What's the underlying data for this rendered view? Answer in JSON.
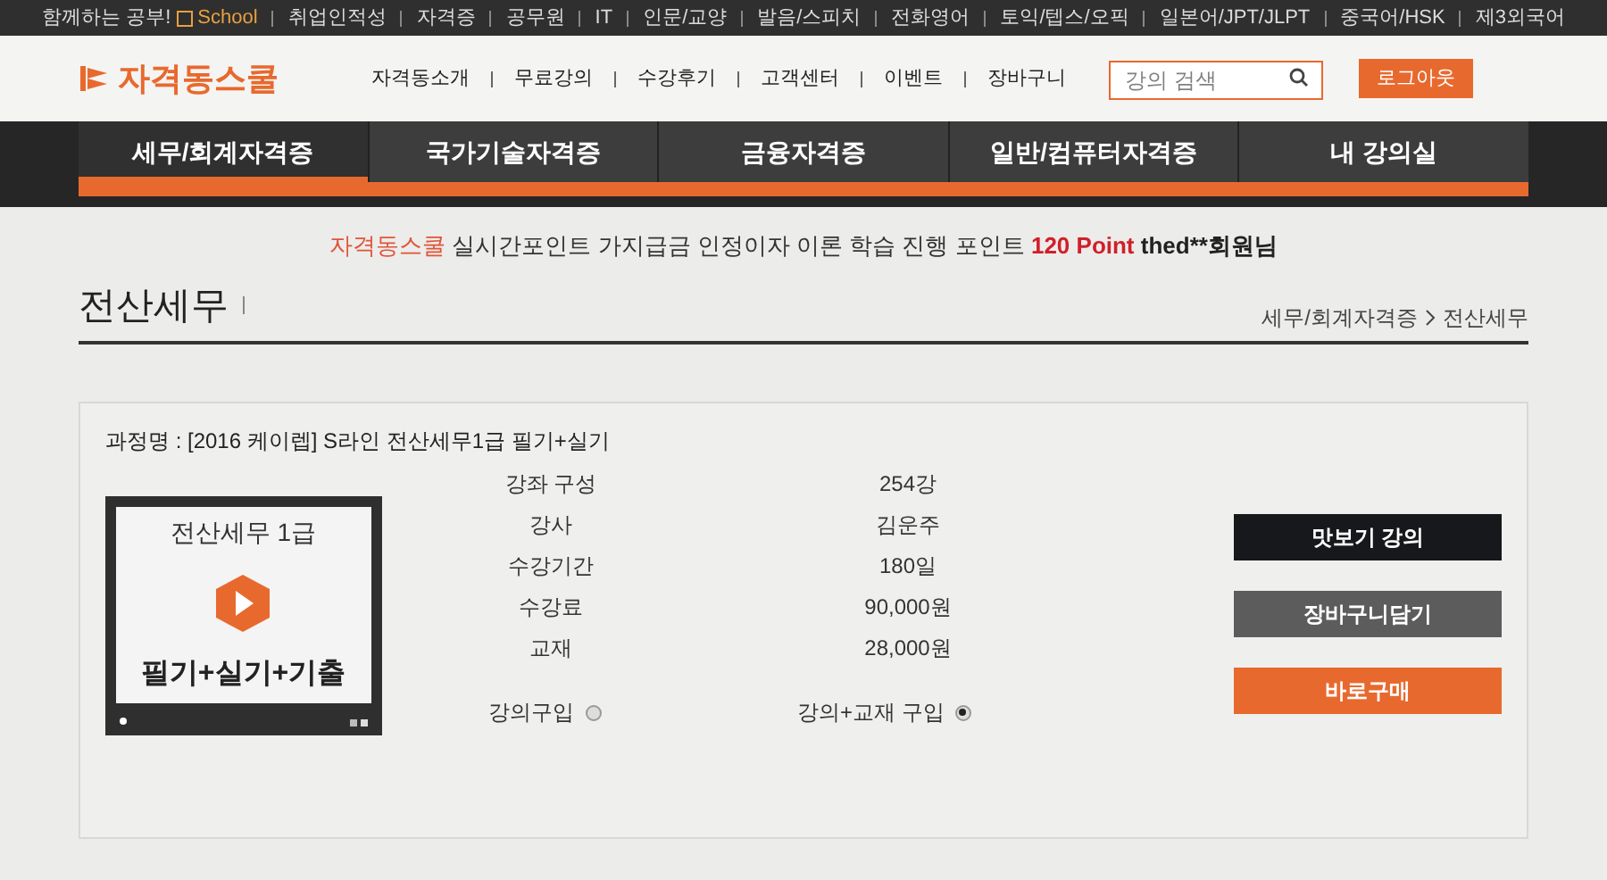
{
  "top_bar": {
    "slogan": "함께하는 공부!",
    "school": "School",
    "links": [
      "취업인적성",
      "자격증",
      "공무원",
      "IT",
      "인문/교양",
      "발음/스피치",
      "전화영어",
      "토익/텝스/오픽",
      "일본어/JPT/JLPT",
      "중국어/HSK",
      "제3외국어"
    ]
  },
  "header": {
    "logo": "자격동스쿨",
    "menu": [
      "자격동소개",
      "무료강의",
      "수강후기",
      "고객센터",
      "이벤트",
      "장바구니"
    ],
    "search": {
      "placeholder": "강의 검색"
    },
    "logout": "로그아웃"
  },
  "nav": [
    {
      "label": "세무/회계자격증",
      "selected": true
    },
    {
      "label": "국가기술자격증",
      "selected": false
    },
    {
      "label": "금융자격증",
      "selected": false
    },
    {
      "label": "일반/컴퓨터자격증",
      "selected": false
    },
    {
      "label": "내 강의실",
      "selected": false
    }
  ],
  "notice": [
    {
      "kind": "brand",
      "text": "자격동스쿨"
    },
    {
      "kind": "plain",
      "text": " 실시간포인트 가지급금 인정이자 이론 학습 진행 포인트 "
    },
    {
      "kind": "points",
      "text": "120 Point"
    },
    {
      "kind": "user",
      "text": " thed**회원님"
    }
  ],
  "page_title": "전산세무",
  "breadcrumb": [
    "세무/회계자격증",
    "전산세무"
  ],
  "course": {
    "name": "과정명 : [2016 케이렙] S라인 전산세무1급 필기+실기",
    "thumbnail": {
      "title": "전산세무 1급",
      "subtitle": "필기+실기+기출"
    },
    "details": [
      {
        "label": "강좌 구성",
        "value": "254강"
      },
      {
        "label": "강사",
        "value": "김운주"
      },
      {
        "label": "수강기간",
        "value": "180일"
      },
      {
        "label": "수강료",
        "value": "90,000원"
      },
      {
        "label": "교재",
        "value": "28,000원"
      }
    ],
    "options": [
      {
        "label": "강의구입",
        "selected": false
      },
      {
        "label": "강의+교재 구입",
        "selected": true
      }
    ],
    "buttons": [
      {
        "kind": "preview",
        "label": "맛보기 강의"
      },
      {
        "kind": "cart",
        "label": "장바구니담기"
      },
      {
        "kind": "buy",
        "label": "바로구매"
      }
    ]
  }
}
